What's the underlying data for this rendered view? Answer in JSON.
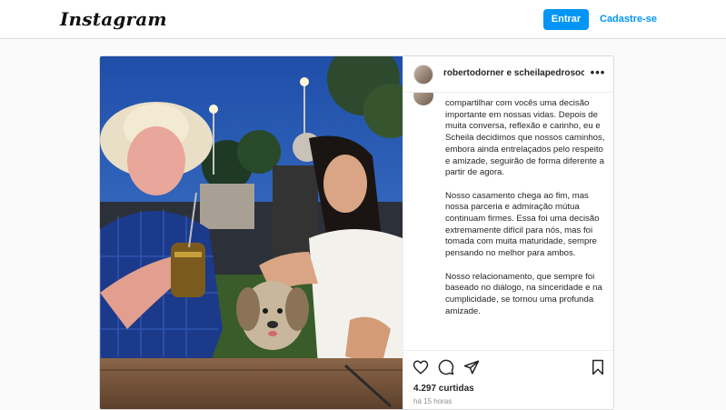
{
  "header": {
    "logo_text": "Instagram",
    "login_label": "Entrar",
    "signup_label": "Cadastre-se",
    "accent_color": "#0095f6"
  },
  "post": {
    "username": "robertodorner e scheilapedrosoc",
    "more_icon": "more-horizontal-icon",
    "caption_paragraphs": [
      "compartilhar com vocês uma decisão importante em nossas vidas. Depois de muita conversa, reflexão e carinho, eu e Scheila decidimos que nossos caminhos, embora ainda entrelaçados pelo respeito e amizade, seguirão de forma diferente a partir de agora.",
      "Nosso casamento chega ao fim, mas nossa parceria e admiração mútua continuam firmes. Essa foi uma decisão extremamente difícil para nós, mas foi tomada com muita maturidade, sempre pensando no melhor para ambos.",
      "Nosso relacionamento, que sempre foi baseado no diálogo, na sinceridade e na cumplicidade, se tornou uma profunda amizade."
    ],
    "likes_text": "4.297 curtidas",
    "time_text": "há 15 horas",
    "icons": [
      "heart-icon",
      "comment-icon",
      "share-icon",
      "bookmark-icon"
    ]
  }
}
